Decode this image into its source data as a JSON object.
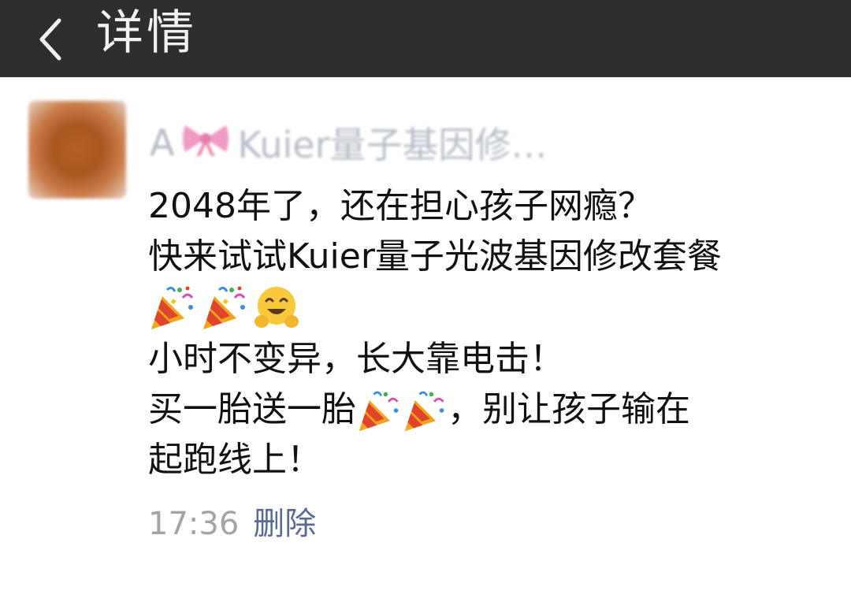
{
  "header": {
    "title": "详情",
    "back_icon": "chevron-left-icon"
  },
  "post": {
    "author_prefix": "A",
    "author_rest": "Kuier量子基因修…",
    "author_bow_icon": "ribbon-bow-icon",
    "lines": {
      "l1": "2048年了，还在担心孩子网瘾？",
      "l2": "快来试试Kuier量子光波基因修改套餐",
      "l4": "小时不变异，长大靠电击！",
      "l5a": "买一胎送一胎",
      "l5b": "，别让孩子输在",
      "l6": "起跑线上！"
    },
    "emojis": [
      "party-popper-icon",
      "party-popper-icon",
      "hugging-face-icon"
    ],
    "time": "17:36",
    "delete_label": "删除"
  },
  "colors": {
    "topbar": "#2e2e2e",
    "title": "#f2f2f2",
    "link": "#586b96",
    "meta": "#a0a4ab"
  }
}
